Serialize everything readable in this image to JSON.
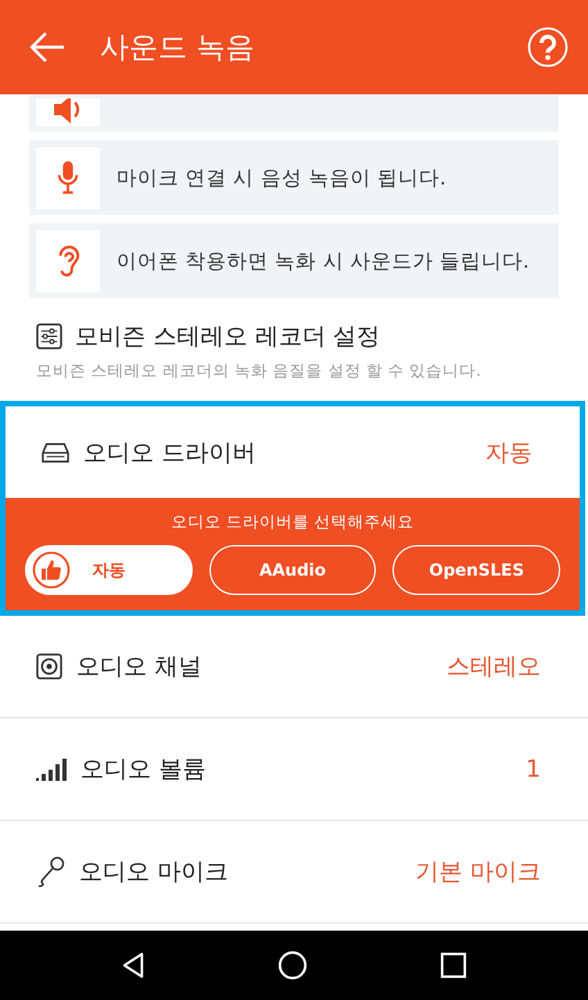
{
  "header": {
    "title": "사운드 녹음"
  },
  "info_cards": [
    {
      "kind": "speaker"
    },
    {
      "kind": "mic",
      "text": "마이크 연결 시 음성 녹음이 됩니다."
    },
    {
      "kind": "ear",
      "text": "이어폰 착용하면 녹화 시 사운드가 들립니다."
    }
  ],
  "recorder_settings": {
    "title": "모비즌 스테레오 레코더 설정",
    "subtitle": "모비즌 스테레오 레코더의 녹화 음질을 설정 할 수 있습니다."
  },
  "audio_driver": {
    "label": "오디오 드라이버",
    "value": "자동",
    "prompt": "오디오 드라이버를 선택해주세요",
    "options": [
      {
        "label": "자동",
        "selected": true
      },
      {
        "label": "AAudio",
        "selected": false
      },
      {
        "label": "OpenSLES",
        "selected": false
      }
    ]
  },
  "settings": [
    {
      "kind": "channel",
      "label": "오디오 채널",
      "value": "스테레오"
    },
    {
      "kind": "volume",
      "label": "오디오 볼륨",
      "value": "1"
    },
    {
      "kind": "mic",
      "label": "오디오 마이크",
      "value": "기본 마이크"
    }
  ]
}
